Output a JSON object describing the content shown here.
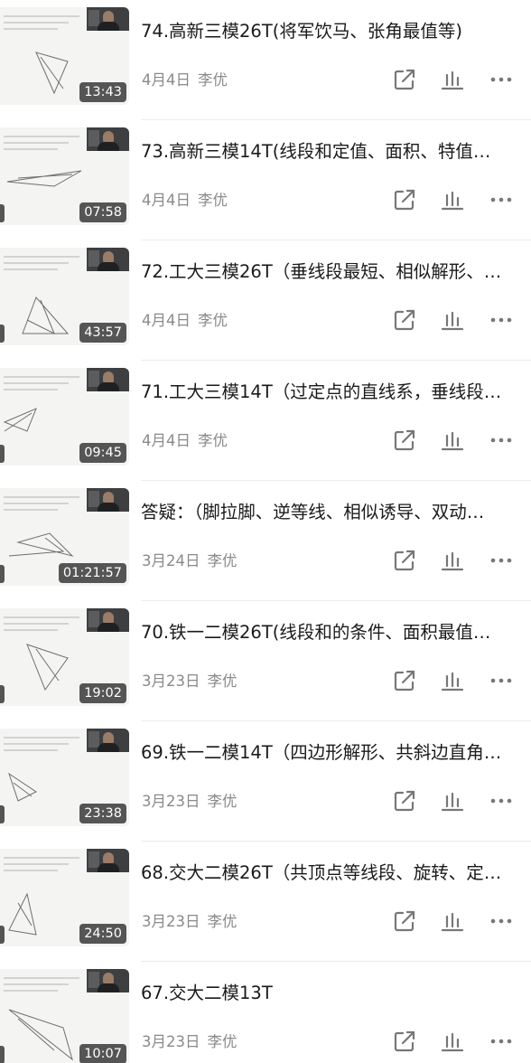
{
  "colors": {
    "title": "#1a1a1a",
    "meta": "#8a8a8a",
    "icon": "#777777",
    "divider": "#ececec",
    "badge_bg": "rgba(40,40,40,0.78)"
  },
  "icons": {
    "share": "share-out-icon",
    "stats": "bar-chart-icon",
    "more": "more-dots-icon"
  },
  "videos": [
    {
      "title": "74.高新三模26T(将军饮马、张角最值等)",
      "date": "4月4日",
      "author": "李优",
      "duration": "13:43"
    },
    {
      "title": "73.高新三模14T(线段和定值、面积、特值…",
      "date": "4月4日",
      "author": "李优",
      "duration": "07:58"
    },
    {
      "title": "72.工大三模26T（垂线段最短、相似解形、…",
      "date": "4月4日",
      "author": "李优",
      "duration": "43:57"
    },
    {
      "title": "71.工大三模14T（过定点的直线系，垂线段…",
      "date": "4月4日",
      "author": "李优",
      "duration": "09:45"
    },
    {
      "title": "答疑：（脚拉脚、逆等线、相似诱导、双动…",
      "date": "3月24日",
      "author": "李优",
      "duration": "01:21:57"
    },
    {
      "title": "70.铁一二模26T(线段和的条件、面积最值…",
      "date": "3月23日",
      "author": "李优",
      "duration": "19:02"
    },
    {
      "title": "69.铁一二模14T（四边形解形、共斜边直角…",
      "date": "3月23日",
      "author": "李优",
      "duration": "23:38"
    },
    {
      "title": "68.交大二模26T（共顶点等线段、旋转、定…",
      "date": "3月23日",
      "author": "李优",
      "duration": "24:50"
    },
    {
      "title": "67.交大二模13T",
      "date": "3月23日",
      "author": "李优",
      "duration": "10:07"
    }
  ]
}
